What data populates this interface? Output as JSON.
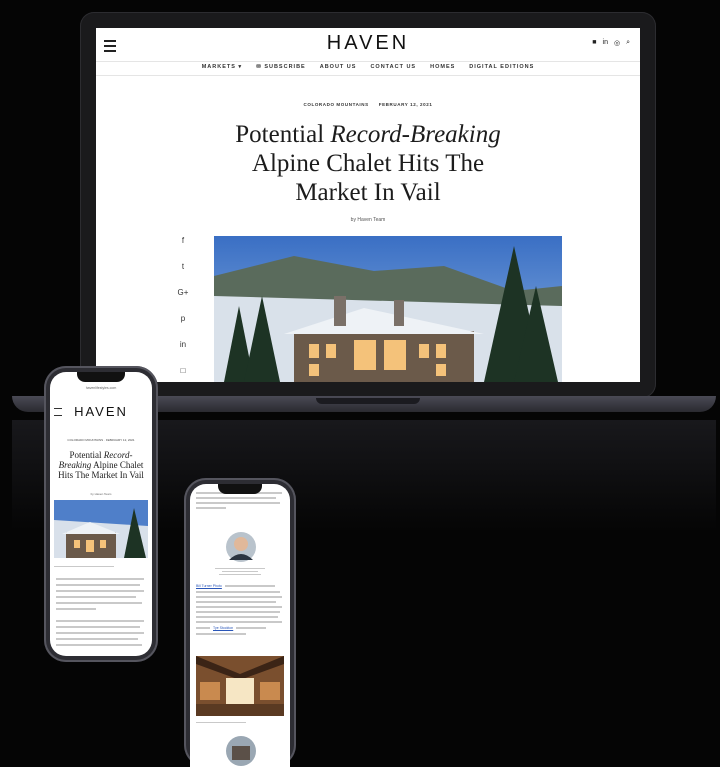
{
  "site": {
    "logo": "HAVEN",
    "nav": [
      "MARKETS ▾",
      "✉ SUBSCRIBE",
      "ABOUT US",
      "CONTACT US",
      "HOMES",
      "DIGITAL EDITIONS"
    ],
    "social_icons": [
      "facebook-icon",
      "linkedin-icon",
      "instagram-icon",
      "search-icon"
    ]
  },
  "article": {
    "tags": [
      "COLORADO MOUNTAINS",
      "FEBRUARY 12, 2021"
    ],
    "title_line1_prefix": "Potential",
    "title_line1_emph": "Record-Breaking",
    "title_line2": "Alpine Chalet Hits The",
    "title_line3": "Market In Vail",
    "byline": "by Haven Team",
    "share_icons": [
      "f",
      "t",
      "G+",
      "p",
      "in",
      "□"
    ]
  },
  "phone_left": {
    "url": "havenlifestyles.com",
    "logo": "HAVEN",
    "tags": "COLORADO MOUNTAINS · FEBRUARY 12, 2021",
    "title_prefix": "Potential",
    "title_emph1": "Record-",
    "title_emph2": "Breaking",
    "title_rest": "Alpine Chalet Hits The Market In Vail",
    "byline": "by Haven Team"
  },
  "phone_right": {
    "link1": "Bill Turner Photo",
    "link2": "Tye Stockton"
  },
  "colors": {
    "background": "#050505",
    "laptop_body": "#1a1a1c",
    "link_blue": "#2a56b8"
  }
}
